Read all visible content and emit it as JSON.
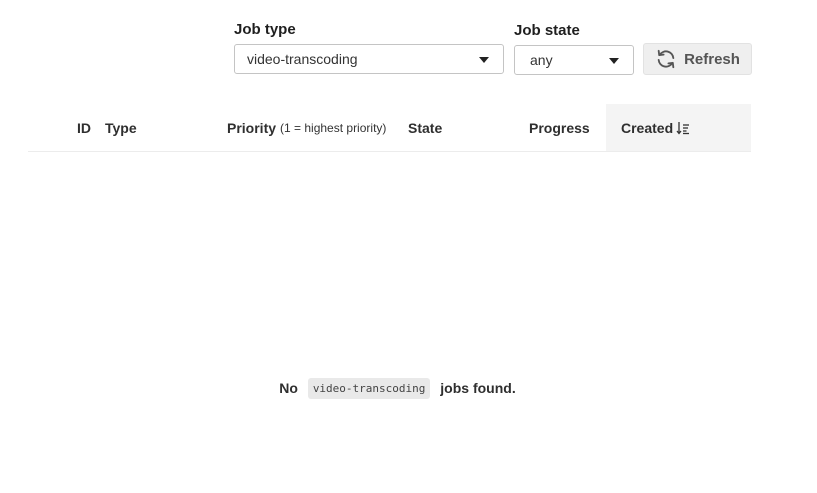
{
  "filters": {
    "job_type_label": "Job type",
    "job_type_value": "video-transcoding",
    "job_state_label": "Job state",
    "job_state_value": "any",
    "refresh_label": "Refresh"
  },
  "table": {
    "columns": {
      "id": "ID",
      "type": "Type",
      "priority": "Priority",
      "priority_note": "(1 = highest priority)",
      "state": "State",
      "progress": "Progress",
      "created": "Created"
    },
    "sorted_column": "created",
    "sort_direction": "descending"
  },
  "empty_state": {
    "prefix": "No",
    "job_type": "video-transcoding",
    "suffix": "jobs found."
  },
  "icons": {
    "refresh": "refresh-icon",
    "sort": "sort-descending-icon",
    "dropdown": "chevron-down-icon"
  }
}
